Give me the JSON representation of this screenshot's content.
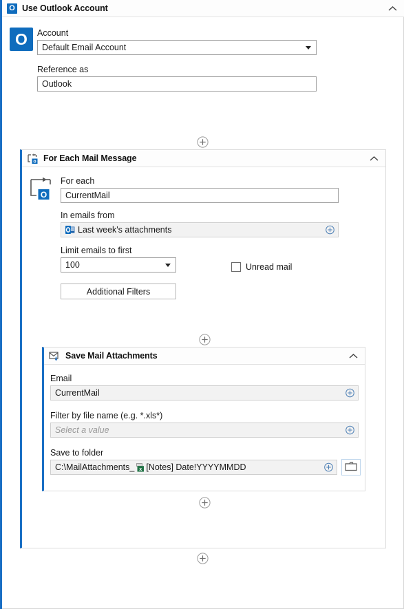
{
  "outlook_block": {
    "title": "Use Outlook Account",
    "icon": "outlook-icon",
    "collapse_icon": "chevron-up-icon",
    "account_label": "Account",
    "account_value": "Default Email Account",
    "reference_label": "Reference as",
    "reference_value": "Outlook"
  },
  "foreach_block": {
    "title": "For Each Mail Message",
    "icon": "loop-outlook-icon",
    "collapse_icon": "chevron-up-icon",
    "foreach_label": "For each",
    "foreach_value": "CurrentMail",
    "inemails_label": "In emails from",
    "inemails_value": "Last week's attachments",
    "inemails_icon": "outlook-folder-icon",
    "limit_label": "Limit emails to first",
    "limit_value": "100",
    "unread_label": "Unread mail",
    "unread_checked": false,
    "additional_filters_label": "Additional Filters"
  },
  "save_block": {
    "title": "Save Mail Attachments",
    "icon": "mail-download-icon",
    "collapse_icon": "chevron-up-icon",
    "email_label": "Email",
    "email_value": "CurrentMail",
    "filter_label": "Filter by file name (e.g. *.xls*)",
    "filter_placeholder": "Select a value",
    "folder_label": "Save to folder",
    "folder_prefix": "C:\\MailAttachments_",
    "folder_token_icon": "excel-icon",
    "folder_suffix": "[Notes] Date!YYYYMMDD",
    "browse_icon": "folder-icon"
  },
  "add_buttons": [
    {
      "name": "add-step-after-outlook",
      "icon": "plus-circle-icon"
    },
    {
      "name": "add-step-inside-foreach",
      "icon": "plus-circle-icon"
    },
    {
      "name": "add-step-after-save",
      "icon": "plus-circle-icon"
    },
    {
      "name": "add-step-after-foreach",
      "icon": "plus-circle-icon"
    }
  ],
  "colors": {
    "accent": "#1a6fc4",
    "outlook_blue": "#0f6cbd",
    "excel_green": "#217346",
    "border": "#dcdcdc"
  }
}
